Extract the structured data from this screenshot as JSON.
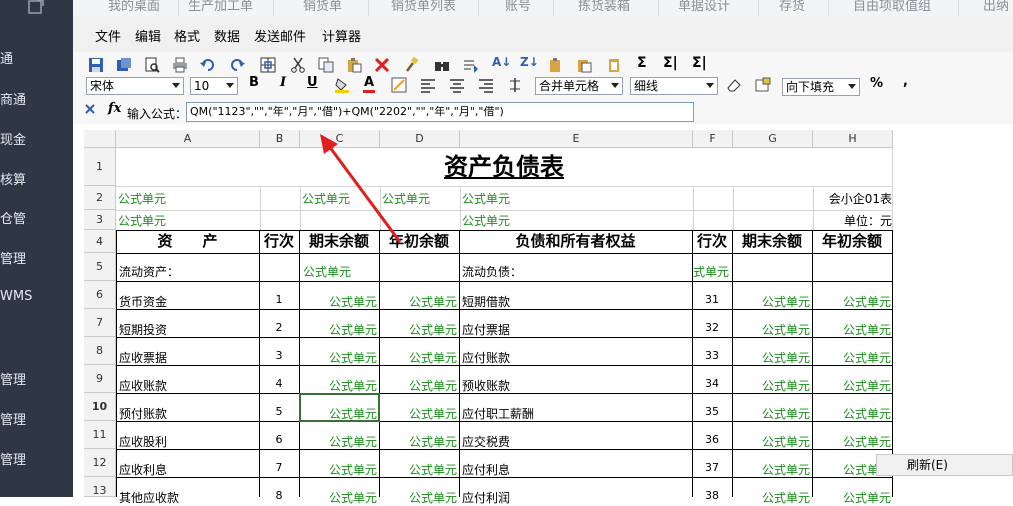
{
  "sidebar": {
    "items": [
      "通",
      "商通",
      "现金",
      "核算",
      "仓管",
      "管理",
      "WMS",
      "管理",
      "管理",
      "管理"
    ]
  },
  "topnav": {
    "tabs": [
      "我的桌面",
      "生产加工单",
      "销货单",
      "销货单列表",
      "账号",
      "拣货装箱",
      "单据设计",
      "存货",
      "自由项取值组",
      "出纳"
    ]
  },
  "menu": {
    "items": [
      "文件",
      "编辑",
      "格式",
      "数据",
      "发送邮件",
      "计算器"
    ]
  },
  "toolbar": {
    "font_name": "宋体",
    "font_size": "10",
    "merge": "合并单元格",
    "border": "细线",
    "fill": "向下填充",
    "bold": "B",
    "italic": "I",
    "underline": "U",
    "font_color": "A",
    "percent": "%",
    "comma": ","
  },
  "formula": {
    "label": "输入公式：",
    "value": "QM(\"1123\",\"\",\"年\",\"月\",\"借\")+QM(\"2202\",\"\",\"年\",\"月\",\"借\")"
  },
  "columns": [
    "A",
    "B",
    "C",
    "D",
    "E",
    "F",
    "G",
    "H"
  ],
  "rows": [
    "1",
    "2",
    "3",
    "4",
    "5",
    "6",
    "7",
    "8",
    "9",
    "10",
    "11",
    "12",
    "13"
  ],
  "sheet": {
    "title": "资产负债表",
    "formula_cell": "公式单元",
    "company_code": "会小企01表",
    "unit": "单位：元",
    "headers": {
      "asset": "资　　产",
      "line": "行次",
      "end_balance": "期末余额",
      "begin_balance": "年初余额",
      "liab": "负债和所有者权益"
    },
    "left_section": "流动资产：",
    "right_section": "流动负债：",
    "col_f_row5": "式单元",
    "asset_rows": [
      {
        "name": "货币资金",
        "line": "1"
      },
      {
        "name": "短期投资",
        "line": "2"
      },
      {
        "name": "应收票据",
        "line": "3"
      },
      {
        "name": "应收账款",
        "line": "4"
      },
      {
        "name": "预付账款",
        "line": "5"
      },
      {
        "name": "应收股利",
        "line": "6"
      },
      {
        "name": "应收利息",
        "line": "7"
      },
      {
        "name": "其他应收款",
        "line": "8"
      }
    ],
    "liab_rows": [
      {
        "name": "短期借款",
        "line": "31"
      },
      {
        "name": "应付票据",
        "line": "32"
      },
      {
        "name": "应付账款",
        "line": "33"
      },
      {
        "name": "预收账款",
        "line": "34"
      },
      {
        "name": "应付职工薪酬",
        "line": "35"
      },
      {
        "name": "应交税费",
        "line": "36"
      },
      {
        "name": "应付利息",
        "line": "37"
      },
      {
        "name": "应付利润",
        "line": "38"
      }
    ]
  },
  "context_menu": {
    "refresh": "刷新(E)"
  },
  "colors": {
    "sidebar": "#2f3644",
    "formula_text": "#1a8c1a",
    "arrow": "#e02020"
  }
}
